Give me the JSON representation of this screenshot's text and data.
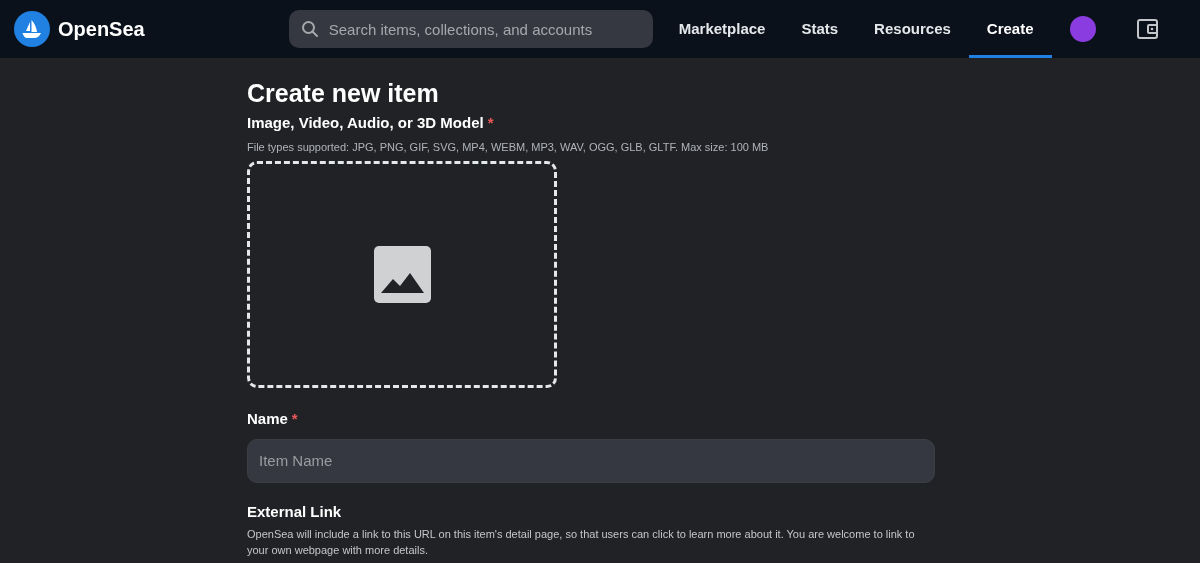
{
  "header": {
    "brand": "OpenSea",
    "search": {
      "placeholder": "Search items, collections, and accounts"
    },
    "nav": [
      {
        "label": "Marketplace",
        "selected": false
      },
      {
        "label": "Stats",
        "selected": false
      },
      {
        "label": "Resources",
        "selected": false
      },
      {
        "label": "Create",
        "selected": true
      }
    ]
  },
  "page": {
    "title": "Create new item",
    "media": {
      "label": "Image, Video, Audio, or 3D Model",
      "required_mark": "*",
      "hint": "File types supported: JPG, PNG, GIF, SVG, MP4, WEBM, MP3, WAV, OGG, GLB, GLTF. Max size: 100 MB"
    },
    "name": {
      "label": "Name",
      "required_mark": "*",
      "placeholder": "Item Name"
    },
    "external_link": {
      "label": "External Link",
      "description": "OpenSea will include a link to this URL on this item's detail page, so that users can click to learn more about it. You are welcome to link to your own webpage with more details."
    }
  }
}
